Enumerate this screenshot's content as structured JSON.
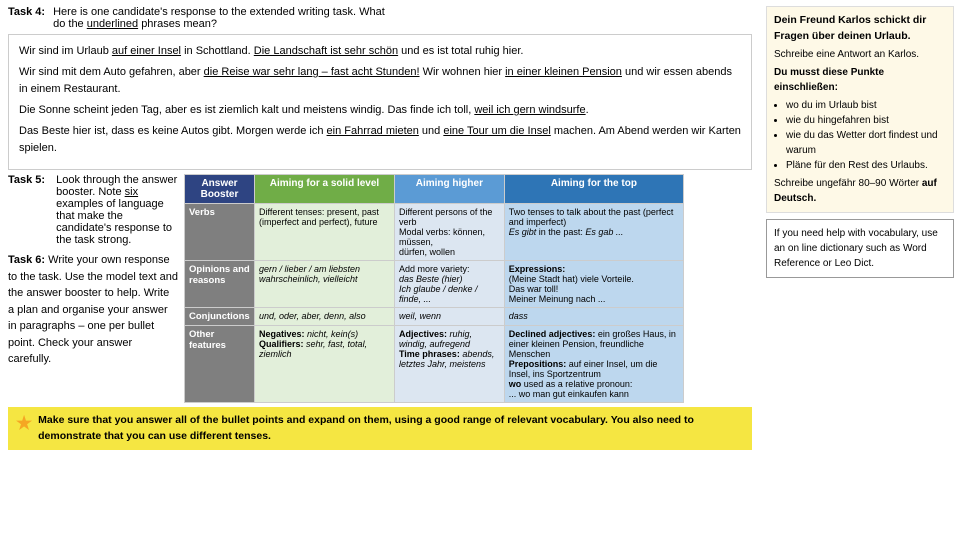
{
  "task4": {
    "label": "Task 4:",
    "instruction_line1": "Here is one candidate's response to the extended writing task.  What",
    "instruction_line2": "do the",
    "underlined_word": "underlined",
    "instruction_end": "phrases mean?"
  },
  "german_text": {
    "para1": "Wir sind im Urlaub auf einer Insel in Schottland. Die Landschaft ist sehr schön und es ist total ruhig hier.",
    "para2": "Wir sind mit dem Auto gefahren, aber die Reise war sehr lang – fast acht Stunden! Wir wohnen hier in einer kleinen Pension und wir essen abends in einem Restaurant.",
    "para3": "Die Sonne scheint jeden Tag, aber es ist ziemlich kalt und meistens windig. Das finde ich toll, weil ich gern windsurfe.",
    "para4": "Das Beste hier ist, dass es keine Autos gibt. Morgen werde ich ein Fahrrad mieten und eine Tour um die Insel machen. Am Abend werden wir Karten spielen."
  },
  "german_card": {
    "title": "Dein Freund Karlos schickt dir Fragen über deinen Urlaub.",
    "subtitle": "Schreibe eine Antwort an Karlos.",
    "must_text": "Du musst diese Punkte einschließen:",
    "bullets": [
      "wo du im Urlaub bist",
      "wie du hingefahren bist",
      "wie du das Wetter dort findest und warum",
      "Pläne für den Rest des Urlaubs."
    ],
    "word_count": "Schreibe ungefähr 80–90 Wörter auf Deutsch."
  },
  "dict_tip": {
    "text": "If you need help with vocabulary, use an on line dictionary such as Word Reference or Leo Dict."
  },
  "task5": {
    "label": "Task 5:",
    "text": "Look through the answer booster. Note",
    "link_text": "six",
    "text2": "examples of language that make the candidate's response to the task strong."
  },
  "task6": {
    "label": "Task 6:",
    "text": "Write your own response to the task.  Use the model text and the answer booster to help.  Write a plan and organise your answer in paragraphs – one per bullet point.  Check your answer carefully."
  },
  "reminder": {
    "text": "Make sure that you answer all of the bullet points and expand on them, using a good range of relevant vocabulary. You also need to demonstrate that you can use different tenses."
  },
  "booster": {
    "header_left": "Answer Booster",
    "col1": "Aiming for a solid level",
    "col2": "Aiming higher",
    "col3": "Aiming for the top",
    "rows": [
      {
        "category": "Verbs",
        "solid": "Different tenses: present, past (imperfect and perfect), future",
        "higher": "Different persons of the verb\nModal verbs: können, müssen, dürfen, wollen",
        "top": "Two tenses to talk about the past (perfect and imperfect)\nEs gibt in the past: Es gab ..."
      },
      {
        "category": "Opinions and reasons",
        "solid": "gern / lieber / am liebsten\nwahrscheinlich, vielleicht",
        "higher": "Add more variety:\ndas Beste (hier)\nIch glaube / denke / finde, ...",
        "top": "Expressions:\n(Meine Stadt hat) viele Vorteile.\nDas war toll!\nMeiner Meinung nach ..."
      },
      {
        "category": "Conjunctions",
        "solid": "und, oder, aber, denn, also",
        "higher": "weil, wenn",
        "top": "dass"
      },
      {
        "category": "Other features",
        "solid": "Negatives: nicht, kein(s)\nQualifiers: sehr, fast, total, ziemlich",
        "higher": "Adjectives: ruhig, windig, aufregend\nTime phrases: abends, letztes Jahr, meistens",
        "top": "Declined adjectives: ein großes Haus, in einer kleinen Pension, freundliche Menschen\nPrepositions: auf einer Insel, um die Insel, ins Sportzentrum\nwo used as a relative pronoun:\n... wo man gut einkaufen kann"
      }
    ]
  }
}
